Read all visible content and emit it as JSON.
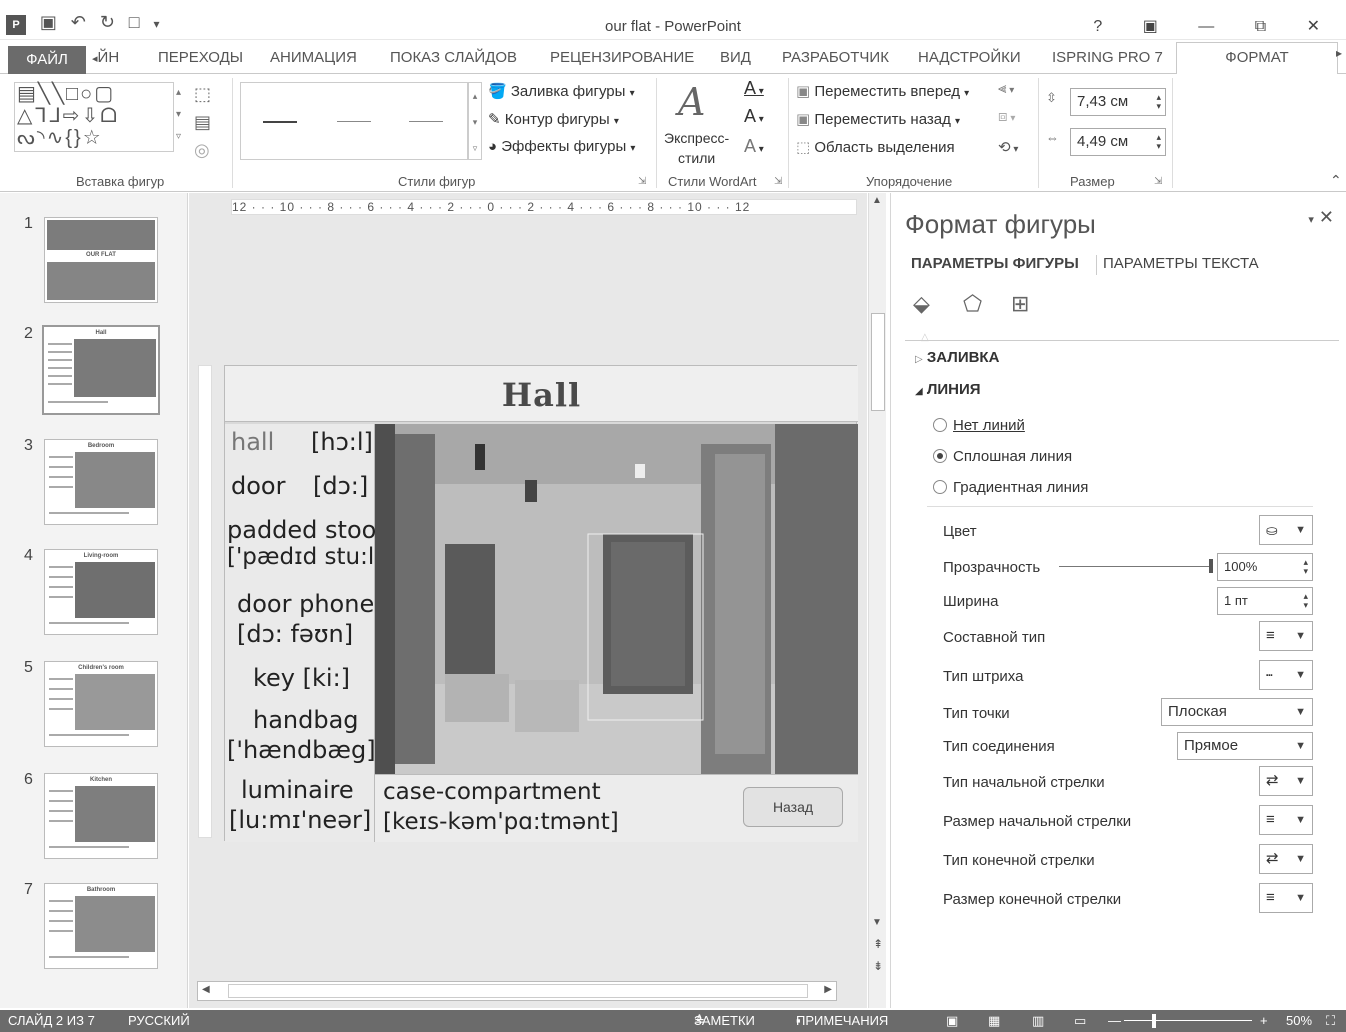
{
  "app": {
    "title": "our flat - PowerPoint",
    "window_controls": "? ▣ — ⧉ ✕"
  },
  "tabs": {
    "file": "ФАЙЛ",
    "items": [
      "ЙН",
      "ПЕРЕХОДЫ",
      "АНИМАЦИЯ",
      "ПОКАЗ СЛАЙДОВ",
      "РЕЦЕНЗИРОВАНИЕ",
      "ВИД",
      "РАЗРАБОТЧИК",
      "НАДСТРОЙКИ",
      "ISPRING PRO 7"
    ],
    "active": "ФОРМАТ"
  },
  "ribbon": {
    "groups": {
      "insert_shapes": "Вставка фигур",
      "shape_styles": "Стили фигур",
      "wordart": "Стили WordArt",
      "arrange": "Упорядочение",
      "size": "Размер"
    },
    "fill": "Заливка фигуры",
    "outline": "Контур фигуры",
    "effects": "Эффекты фигуры",
    "express_styles": "Экспресс-\nстили",
    "bring_forward": "Переместить вперед",
    "send_backward": "Переместить назад",
    "selection_pane": "Область выделения",
    "height": "7,43 см",
    "width": "4,49 см"
  },
  "thumbnails": {
    "numbers": [
      "1",
      "2",
      "3",
      "4",
      "5",
      "6",
      "7"
    ],
    "titles": [
      "OUR FLAT",
      "Hall",
      "Bedroom",
      "Living-room",
      "Children's room",
      "Kitchen",
      "Bathroom"
    ]
  },
  "ruler": "12 · · · 10 · · · 8 · · · 6 · · · 4 · · · 2 · · · 0 · · · 2 · · · 4 · · · 6 · · · 8 · · · 10 · · · 12",
  "slide": {
    "title": "Hall",
    "vocab": [
      {
        "word": "hall",
        "trans": "[hɔ:l]"
      },
      {
        "word": "door",
        "trans": "[dɔ:]"
      },
      {
        "word": "padded stool",
        "trans": "['pædɪd stu:l]"
      },
      {
        "word": "door phone",
        "trans": "[dɔ: fəʊn]"
      },
      {
        "word": "key [ki:]"
      },
      {
        "word": "handbag",
        "trans": "['hændbæg]"
      },
      {
        "word": "luminaire",
        "trans": "[lu:mɪ'neər]"
      }
    ],
    "caption_word": "case-compartment",
    "caption_trans": "[keɪs-kəm'pɑ:tmənt]",
    "back_button": "Назад"
  },
  "pane": {
    "title": "Формат фигуры",
    "tab_shape": "ПАРАМЕТРЫ ФИГУРЫ",
    "tab_text": "ПАРАМЕТРЫ ТЕКСТА",
    "fill_section": "ЗАЛИВКА",
    "line_section": "ЛИНИЯ",
    "no_line": "Нет линий",
    "solid_line": "Сплошная линия",
    "gradient_line": "Градиентная линия",
    "color": "Цвет",
    "transparency": "Прозрачность",
    "transparency_value": "100%",
    "transparency_level": 1.0,
    "width_label": "Ширина",
    "width_value": "1 пт",
    "compound": "Составной тип",
    "dash": "Тип штриха",
    "cap": "Тип точки",
    "cap_value": "Плоская",
    "join": "Тип соединения",
    "join_value": "Прямое",
    "begin_arrow_type": "Тип начальной стрелки",
    "begin_arrow_size": "Размер начальной стрелки",
    "end_arrow_type": "Тип конечной стрелки",
    "end_arrow_size": "Размер конечной стрелки"
  },
  "status": {
    "slide": "СЛАЙД 2 ИЗ 7",
    "lang": "РУССКИЙ",
    "notes": "ЗАМЕТКИ",
    "comments": "ПРИМЕЧАНИЯ",
    "zoom": "50%"
  }
}
